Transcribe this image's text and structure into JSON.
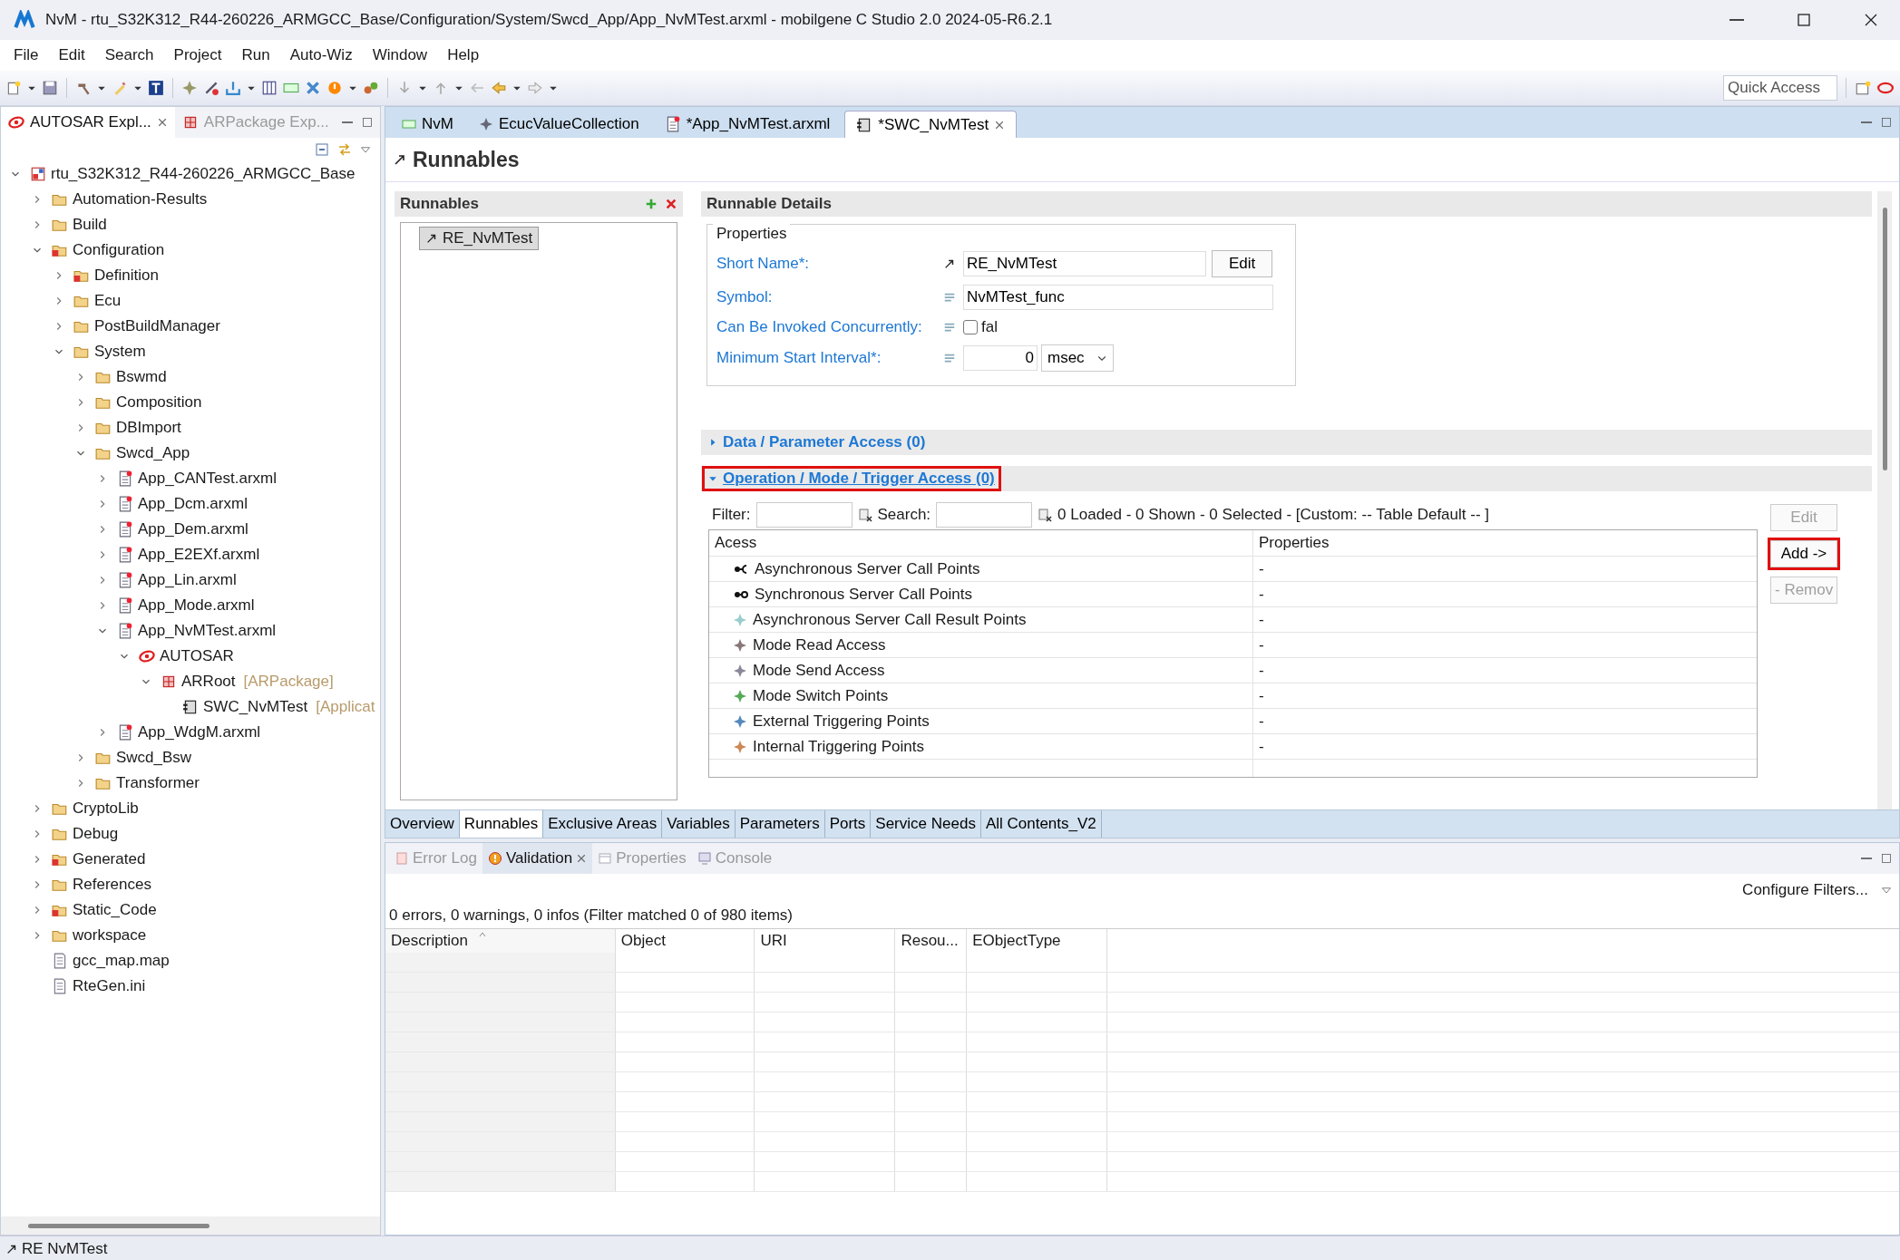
{
  "window": {
    "title": "NvM - rtu_S32K312_R44-260226_ARMGCC_Base/Configuration/System/Swcd_App/App_NvMTest.arxml - mobilgene C Studio 2.0 2024-05-R6.2.1"
  },
  "menu": [
    "File",
    "Edit",
    "Search",
    "Project",
    "Run",
    "Auto-Wiz",
    "Window",
    "Help"
  ],
  "quick_access": {
    "placeholder": "Quick Access"
  },
  "explorer": {
    "tabs": [
      {
        "label": "AUTOSAR Expl...",
        "selected": true
      },
      {
        "label": "ARPackage Exp...",
        "selected": false
      }
    ],
    "tree": [
      {
        "label": "rtu_S32K312_R44-260226_ARMGCC_Base",
        "kind": "project",
        "expanded": true,
        "children": [
          {
            "label": "Automation-Results",
            "kind": "folder",
            "expanded": false
          },
          {
            "label": "Build",
            "kind": "folder",
            "expanded": false
          },
          {
            "label": "Configuration",
            "kind": "folder-error",
            "expanded": true,
            "children": [
              {
                "label": "Definition",
                "kind": "folder-error",
                "expanded": false
              },
              {
                "label": "Ecu",
                "kind": "folder",
                "expanded": false
              },
              {
                "label": "PostBuildManager",
                "kind": "folder",
                "expanded": false
              },
              {
                "label": "System",
                "kind": "folder",
                "expanded": true,
                "children": [
                  {
                    "label": "Bswmd",
                    "kind": "folder",
                    "expanded": false
                  },
                  {
                    "label": "Composition",
                    "kind": "folder",
                    "expanded": false
                  },
                  {
                    "label": "DBImport",
                    "kind": "folder",
                    "expanded": false
                  },
                  {
                    "label": "Swcd_App",
                    "kind": "folder",
                    "expanded": true,
                    "children": [
                      {
                        "label": "App_CANTest.arxml",
                        "kind": "arxml",
                        "expanded": false
                      },
                      {
                        "label": "App_Dcm.arxml",
                        "kind": "arxml",
                        "expanded": false
                      },
                      {
                        "label": "App_Dem.arxml",
                        "kind": "arxml",
                        "expanded": false
                      },
                      {
                        "label": "App_E2EXf.arxml",
                        "kind": "arxml",
                        "expanded": false
                      },
                      {
                        "label": "App_Lin.arxml",
                        "kind": "arxml",
                        "expanded": false
                      },
                      {
                        "label": "App_Mode.arxml",
                        "kind": "arxml",
                        "expanded": false
                      },
                      {
                        "label": "App_NvMTest.arxml",
                        "kind": "arxml",
                        "expanded": true,
                        "children": [
                          {
                            "label": "AUTOSAR",
                            "kind": "autosar",
                            "expanded": true,
                            "children": [
                              {
                                "label": "ARRoot",
                                "suffix": "[ARPackage]",
                                "kind": "package",
                                "expanded": true,
                                "children": [
                                  {
                                    "label": "SWC_NvMTest",
                                    "suffix": "[Applicat",
                                    "kind": "component"
                                  }
                                ]
                              }
                            ]
                          }
                        ]
                      },
                      {
                        "label": "App_WdgM.arxml",
                        "kind": "arxml",
                        "expanded": false
                      }
                    ]
                  },
                  {
                    "label": "Swcd_Bsw",
                    "kind": "folder",
                    "expanded": false
                  },
                  {
                    "label": "Transformer",
                    "kind": "folder",
                    "expanded": false
                  }
                ]
              }
            ]
          },
          {
            "label": "CryptoLib",
            "kind": "folder",
            "expanded": false
          },
          {
            "label": "Debug",
            "kind": "folder",
            "expanded": false
          },
          {
            "label": "Generated",
            "kind": "folder-error",
            "expanded": false
          },
          {
            "label": "References",
            "kind": "folder",
            "expanded": false
          },
          {
            "label": "Static_Code",
            "kind": "folder-error",
            "expanded": false
          },
          {
            "label": "workspace",
            "kind": "folder",
            "expanded": false
          },
          {
            "label": "gcc_map.map",
            "kind": "text-file"
          },
          {
            "label": "RteGen.ini",
            "kind": "text-file"
          }
        ]
      }
    ]
  },
  "editor": {
    "tabs": [
      {
        "label": "NvM",
        "kind": "module",
        "selected": false
      },
      {
        "label": "EcucValueCollection",
        "kind": "collection",
        "selected": false
      },
      {
        "label": "*App_NvMTest.arxml",
        "kind": "arxml",
        "selected": false
      },
      {
        "label": "*SWC_NvMTest",
        "kind": "component",
        "selected": true
      }
    ],
    "title": "Runnables",
    "runnables": {
      "title": "Runnables",
      "items": [
        {
          "label": "RE_NvMTest",
          "selected": true
        }
      ]
    },
    "details": {
      "title": "Runnable Details",
      "group": "Properties",
      "short_name": {
        "label": "Short Name*:",
        "value": "RE_NvMTest",
        "button": "Edit"
      },
      "symbol": {
        "label": "Symbol:",
        "value": "NvMTest_func"
      },
      "concurrent": {
        "label": "Can Be Invoked Concurrently:",
        "checked": false,
        "text": "fal"
      },
      "min_interval": {
        "label": "Minimum Start Interval*:",
        "value": "0",
        "unit": "msec"
      }
    },
    "sections": [
      {
        "label": "Data / Parameter Access (0)",
        "expanded": false,
        "highlighted": false
      },
      {
        "label": "Operation / Mode / Trigger Access (0)",
        "expanded": true,
        "highlighted": true
      }
    ],
    "filter": {
      "filter_label": "Filter:",
      "search_label": "Search:",
      "summary": "0 Loaded - 0 Shown - 0 Selected -  [Custom: -- Table Default -- ]"
    },
    "access_table": {
      "columns": [
        "Acess",
        "Properties"
      ],
      "rows": [
        {
          "kind": "async-call",
          "access": "Asynchronous Server Call Points",
          "properties": "-"
        },
        {
          "kind": "sync-call",
          "access": "Synchronous Server Call Points",
          "properties": "-"
        },
        {
          "kind": "call-result",
          "access": "Asynchronous Server Call Result Points",
          "properties": "-"
        },
        {
          "kind": "mode-read",
          "access": "Mode Read Access",
          "properties": "-"
        },
        {
          "kind": "mode-send",
          "access": "Mode Send Access",
          "properties": "-"
        },
        {
          "kind": "mode-switch",
          "access": "Mode Switch Points",
          "properties": "-"
        },
        {
          "kind": "external-trigger",
          "access": "External Triggering Points",
          "properties": "-"
        },
        {
          "kind": "internal-trigger",
          "access": "Internal Triggering Points",
          "properties": "-"
        }
      ]
    },
    "actions": [
      {
        "label": "Edit",
        "disabled": true,
        "highlighted": false
      },
      {
        "label": "Add ->",
        "disabled": false,
        "highlighted": true
      },
      {
        "label": "- Remov",
        "disabled": true,
        "highlighted": false
      }
    ],
    "page_tabs": [
      {
        "label": "Overview",
        "selected": false
      },
      {
        "label": "Runnables",
        "selected": true
      },
      {
        "label": "Exclusive Areas",
        "selected": false
      },
      {
        "label": "Variables",
        "selected": false
      },
      {
        "label": "Parameters",
        "selected": false
      },
      {
        "label": "Ports",
        "selected": false
      },
      {
        "label": "Service Needs",
        "selected": false
      },
      {
        "label": "All Contents_V2",
        "selected": false
      }
    ]
  },
  "views": {
    "tabs": [
      {
        "label": "Error Log",
        "kind": "error-log",
        "selected": false
      },
      {
        "label": "Validation",
        "kind": "validation",
        "selected": true
      },
      {
        "label": "Properties",
        "kind": "properties",
        "selected": false
      },
      {
        "label": "Console",
        "kind": "console",
        "selected": false
      }
    ],
    "configure_filters": "Configure Filters...",
    "summary": "0 errors, 0 warnings, 0 infos (Filter matched 0 of 980 items)",
    "columns": [
      {
        "label": "Description",
        "sorted": true
      },
      {
        "label": "Object",
        "sorted": false
      },
      {
        "label": "URI",
        "sorted": false
      },
      {
        "label": "Resou...",
        "sorted": false
      },
      {
        "label": "EObjectType",
        "sorted": false
      }
    ]
  },
  "status_bar": {
    "text": "RE NvMTest"
  }
}
